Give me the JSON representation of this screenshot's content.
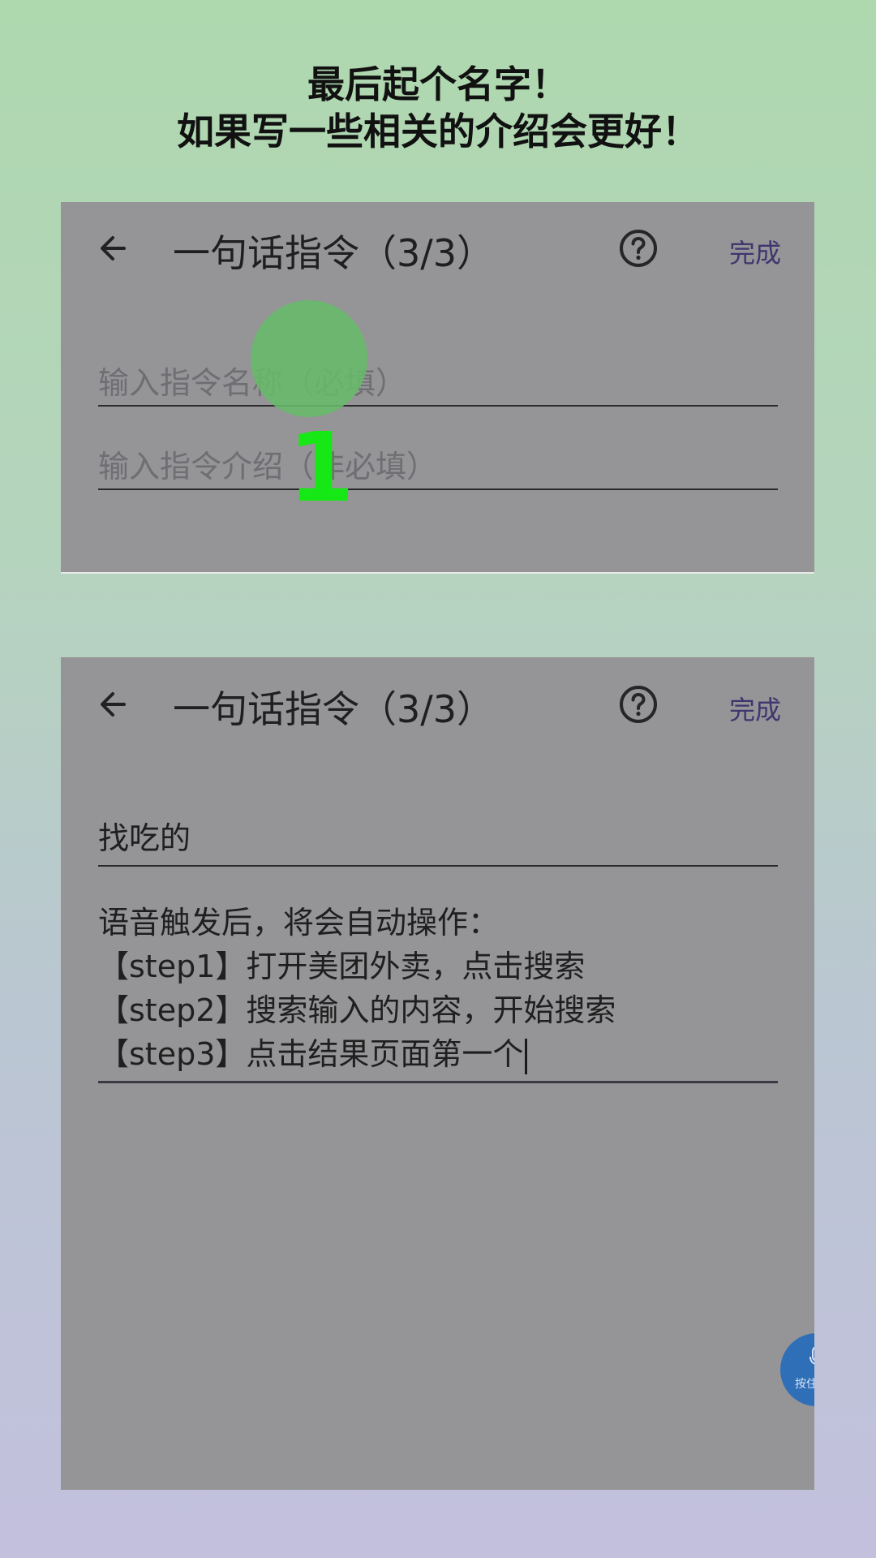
{
  "heading": {
    "line1": "最后起个名字！",
    "line2": "如果写一些相关的介绍会更好！"
  },
  "panel_before": {
    "title": "一句话指令（3/3）",
    "done_label": "完成",
    "name_placeholder": "输入指令名称（必填）",
    "desc_placeholder": "输入指令介绍（非必填）",
    "step_marker": "1",
    "icons": [
      "back-arrow-icon",
      "help-circle-icon"
    ]
  },
  "panel_after": {
    "title": "一句话指令（3/3）",
    "done_label": "完成",
    "name_value": "找吃的",
    "desc_lines": [
      "语音触发后，将会自动操作：",
      "【step1】打开美团外卖，点击搜索",
      "【step2】搜索输入的内容，开始搜索",
      "【step3】点击结果页面第一个"
    ],
    "voice_button_label": "按住",
    "icons": [
      "back-arrow-icon",
      "help-circle-icon",
      "microphone-icon"
    ]
  },
  "colors": {
    "panel_bg": "#959497",
    "touch_indicator": "#66bb6a",
    "marker_number": "#16e816",
    "done_text": "#3f356f",
    "fab": "#2f6fb8"
  }
}
